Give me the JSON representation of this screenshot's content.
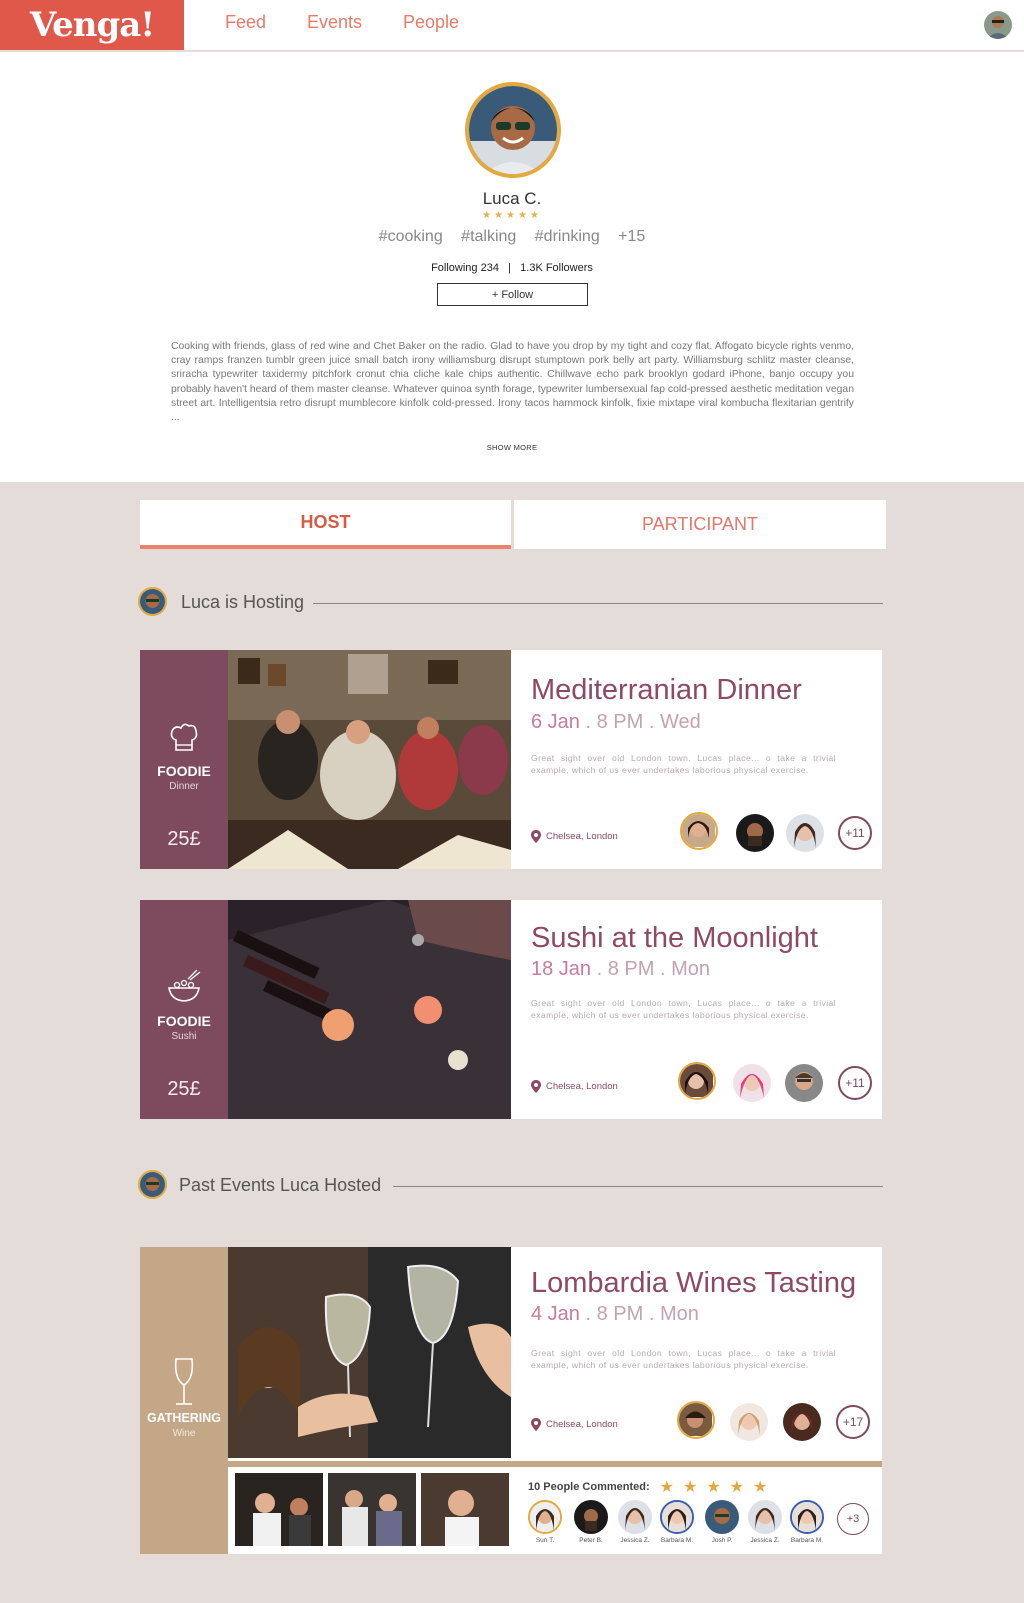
{
  "brand": {
    "logo": "Venga!"
  },
  "nav": {
    "feed": "Feed",
    "events": "Events",
    "people": "People"
  },
  "profile": {
    "name": "Luca C.",
    "rating_stars": "★★★★★",
    "tags": [
      "#cooking",
      "#talking",
      "#drinking",
      "+15"
    ],
    "follow_stats": "Following 234   |   1.3K Followers",
    "follow_button": "+ Follow",
    "bio": "Cooking with friends, glass of red wine and Chet Baker on the radio. Glad to have you drop by my tight and cozy flat. Affogato bicycle rights venmo, cray ramps franzen tumblr green juice small batch irony williamsburg disrupt stumptown pork belly art party. Williamsburg schlitz master cleanse, sriracha typewriter taxidermy pitchfork cronut chia cliche kale chips authentic. Chillwave echo park brooklyn godard iPhone, banjo occupy you probably haven't heard of them master cleanse. Whatever quinoa synth forage, typewriter lumbersexual fap cold-pressed aesthetic meditation vegan street art. Intelligentsia retro disrupt mumblecore kinfolk cold-pressed. Irony tacos hammock kinfolk, fixie mixtape viral kombucha flexitarian gentrify ...",
    "show_more": "SHOW MORE"
  },
  "tabs": {
    "host": "HOST",
    "participant": "PARTICIPANT"
  },
  "sections": {
    "hosting": "Luca is Hosting",
    "past": "Past Events Luca Hosted"
  },
  "events": [
    {
      "category": "FOODIE",
      "subcategory": "Dinner",
      "price": "25£",
      "title": "Mediterranian Dinner",
      "date": "6 Jan",
      "time": ". 8 PM . Wed",
      "description": "Great sight over old London town, Lucas place... o take a trivial example, which of us ever undertakes laborious physical exercise.",
      "location": "Chelsea, London",
      "more_attendees": "+11"
    },
    {
      "category": "FOODIE",
      "subcategory": "Sushi",
      "price": "25£",
      "title": "Sushi at the Moonlight",
      "date": "18 Jan",
      "time": ". 8 PM . Mon",
      "description": "Great sight over old London town, Lucas place... o take a trivial example, which of us ever undertakes laborious physical exercise.",
      "location": "Chelsea, London",
      "more_attendees": "+11"
    }
  ],
  "past_event": {
    "category": "GATHERING",
    "subcategory": "Wine",
    "title": "Lombardia Wines Tasting",
    "date": "4 Jan",
    "time": ". 8 PM . Mon",
    "description": "Great sight over old London town, Lucas place... o take a trivial example, which of us ever undertakes laborious physical exercise.",
    "location": "Chelsea, London",
    "more_attendees": "+17",
    "comments_label": "10 People Commented:",
    "comments_stars": "★★★★★",
    "commenters": [
      "Sun T.",
      "Peter B.",
      "Jessica Z.",
      "Barbara M.",
      "Josh P.",
      "Jessica Z.",
      "Barbara M."
    ],
    "more_commenters": "+3"
  },
  "colors": {
    "brand": "#e0584a",
    "plum": "#7d4a5e",
    "tan": "#c4a787",
    "gold": "#e3a93d",
    "background": "#e3dcd8"
  }
}
